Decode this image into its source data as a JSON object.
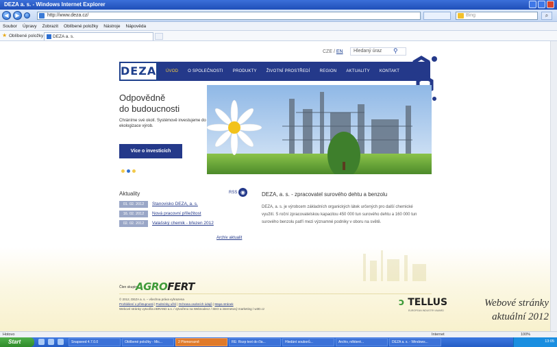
{
  "window": {
    "title": "DEZA a. s. - Windows Internet Explorer",
    "url": "http://www.deza.cz/",
    "search_placeholder": "Bing"
  },
  "menu": [
    "Soubor",
    "Úpravy",
    "Zobrazit",
    "Oblíbené položky",
    "Nástroje",
    "Nápověda"
  ],
  "favorites": {
    "label": "Oblíbené položky",
    "tab_title": "DEZA a. s."
  },
  "site": {
    "lang_cz": "CZE",
    "lang_sep": " / ",
    "lang_en": "EN",
    "search_placeholder": "Hledaný úraz",
    "logo": "DEZA",
    "nav": [
      "ÚVOD",
      "O SPOLEČNOSTI",
      "PRODUKTY",
      "ŽIVOTNÍ PROSTŘEDÍ",
      "REGION",
      "AKTUALITY",
      "KONTAKT"
    ],
    "hero": {
      "title_line1": "Odpovědně",
      "title_line2": "do budoucnosti",
      "text": "Chráníme své okolí. Systémově investujeme do ekologizace výrob.",
      "button": "Více o investicích"
    },
    "news": {
      "title": "Aktuality",
      "rss": "RSS",
      "items": [
        {
          "date": "01. 02. 2012",
          "title": "Stanovisko DEZA, a. s."
        },
        {
          "date": "16. 02. 2012",
          "title": "Nová pracovní příležitost"
        },
        {
          "date": "02. 02. 2012",
          "title": "Valašský chemik - březen 2012"
        }
      ],
      "archive": "Archiv aktualit"
    },
    "about": {
      "title": "DEZA, a. s. - zpracovatel surového dehtu a benzolu",
      "text": "DEZA, a. s. je výrobcem základních organických látek určených pro další chemické využití. S roční zpracovatelskou kapacitou 450 000 tun surového dehtu a 160 000 tun surového benzolu patří mezi významné podniky v oboru na světě."
    },
    "group": {
      "label": "Člen skupiny",
      "logo_agro": "AGRO",
      "logo_fert": "FERT"
    },
    "footer": {
      "copyright": "© 2012, DEZA a. s. – všechna práva vyhrazena",
      "links": [
        "Prohlášení o přístupnosti",
        "Podmínky užití",
        "Ochrana osobních údajů",
        "Mapa stránek"
      ],
      "credit": "Webové stránky vytvořila eBRAND a.s. / vytvořeno na Webnodecz / SEO a internetový marketing / w3D.cz"
    },
    "tellus": {
      "name": "TELLUS",
      "sub": "EUROPEAN INDUSTRY AWARD"
    }
  },
  "caption": {
    "line1": "Webové stránky",
    "line2": "aktuální 2012"
  },
  "statusbar": {
    "left": "Hotovo",
    "zone": "Internet",
    "zoom": "100%"
  },
  "taskbar": {
    "start": "Start",
    "items": [
      "Snapseed 4.7.0.0",
      "Oblíbené položky - Mic...",
      "2 Plomorozně",
      "RE: Rozp text do čla...",
      "Hledání souborů...",
      "Archiv, některé...",
      "DEZA a. s. - Windows..."
    ],
    "clock": "13:05"
  }
}
